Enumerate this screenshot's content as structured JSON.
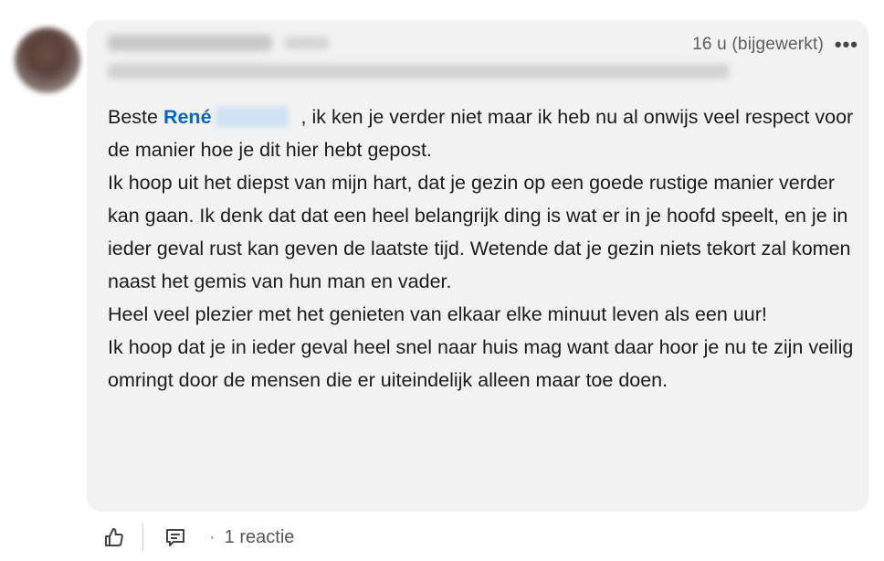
{
  "comment": {
    "author_name": "",
    "timestamp": "16 u (bijgewerkt)",
    "more_label": "•••",
    "paragraphs": [
      {
        "prefix": "Beste ",
        "mention": "René",
        "rest": " , ik ken je verder niet maar ik heb nu al onwijs veel respect voor de manier hoe je dit hier hebt gepost."
      },
      {
        "text": "Ik hoop uit het diepst van mijn hart, dat je gezin op een goede rustige manier verder kan gaan. Ik denk dat dat een heel belangrijk ding is wat er in je hoofd speelt, en je in ieder geval rust kan geven de laatste tijd. Wetende dat je gezin niets tekort zal komen naast het gemis van hun  man en vader."
      },
      {
        "text": "Heel veel plezier met het genieten van elkaar elke minuut leven als een uur!"
      },
      {
        "text": "Ik hoop dat je in ieder geval heel snel naar huis mag want daar hoor je nu te zijn veilig omringt door de mensen die er uiteindelijk alleen maar toe doen."
      }
    ]
  },
  "actions": {
    "like_icon": "thumbs-up-icon",
    "reply_icon": "comment-icon",
    "dot": "·",
    "reply_count": "1 reactie"
  }
}
